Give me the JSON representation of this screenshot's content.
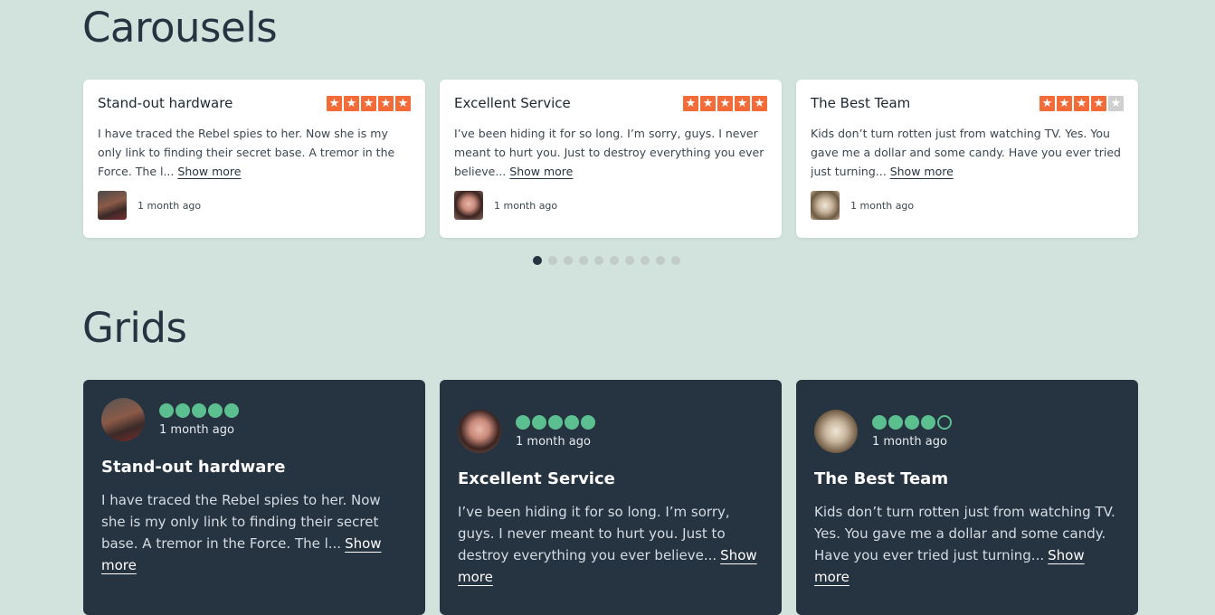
{
  "sections": {
    "carousels_title": "Carousels",
    "grids_title": "Grids"
  },
  "colors": {
    "star_filled": "#f26b38",
    "star_empty": "#cfcfcf",
    "circle": "#5cbf8f",
    "grid_card_bg": "#263340",
    "page_bg": "#d1e3dc"
  },
  "reviews": [
    {
      "title": "Stand-out hardware",
      "rating": 5,
      "excerpt_carousel": "I have traced the Rebel spies to her. Now she is my only link to finding their secret base. A tremor in the Force. The l...",
      "excerpt_grid": "I have traced the Rebel spies to her. Now she is my only link to finding their secret base. A tremor in the Force. The l...",
      "show_more": "Show more",
      "date": "1 month ago",
      "avatar_icon": "avatar-bearded-man"
    },
    {
      "title": "Excellent Service",
      "rating": 5,
      "excerpt_carousel": "I’ve been hiding it for so long. I’m sorry, guys. I never meant to hurt you. Just to destroy everything you ever believe...",
      "excerpt_grid": "I’ve been hiding it for so long. I’m sorry, guys. I never meant to hurt you. Just to destroy everything you ever believe...",
      "show_more": "Show more",
      "date": "1 month ago",
      "avatar_icon": "avatar-woman-dark-hair"
    },
    {
      "title": "The Best Team",
      "rating": 4,
      "excerpt_carousel": "Kids don’t turn rotten just from watching TV. Yes. You gave me a dollar and some candy. Have you ever tried just turning...",
      "excerpt_grid": "Kids don’t turn rotten just from watching TV. Yes. You gave me a dollar and some candy. Have you ever tried just turning...",
      "show_more": "Show more",
      "date": "1 month ago",
      "avatar_icon": "avatar-woman-sunglasses"
    }
  ],
  "carousel": {
    "page_count": 10,
    "active_page": 1
  }
}
